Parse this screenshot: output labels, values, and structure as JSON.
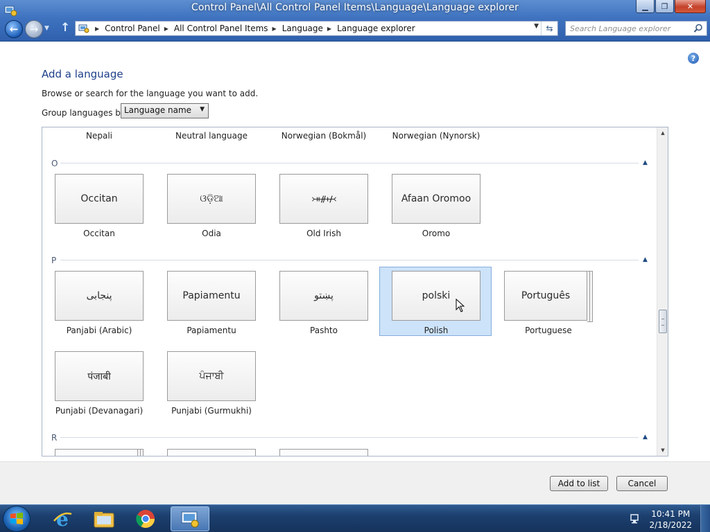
{
  "window": {
    "title": "Control Panel\\All Control Panel Items\\Language\\Language explorer"
  },
  "address": {
    "breadcrumb": [
      "Control Panel",
      "All Control Panel Items",
      "Language",
      "Language explorer"
    ]
  },
  "search": {
    "placeholder": "Search Language explorer"
  },
  "page": {
    "heading": "Add a language",
    "intro": "Browse or search for the language you want to add.",
    "group_label": "Group languages by:",
    "group_value": "Language name"
  },
  "top_row": [
    "Nepali",
    "Neutral language",
    "Norwegian (Bokmål)",
    "Norwegian (Nynorsk)"
  ],
  "sections": [
    {
      "letter": "O",
      "items": [
        {
          "tile": "Occitan",
          "name": "Occitan"
        },
        {
          "tile": "ଓଡ଼ିଆ",
          "name": "Odia"
        },
        {
          "tile": "᚛ᚑᚌᚐᚋ᚜",
          "name": "Old Irish"
        },
        {
          "tile": "Afaan Oromoo",
          "name": "Oromo"
        }
      ]
    },
    {
      "letter": "P",
      "items": [
        {
          "tile": "پنجابی",
          "name": "Panjabi (Arabic)"
        },
        {
          "tile": "Papiamentu",
          "name": "Papiamentu"
        },
        {
          "tile": "پښتو",
          "name": "Pashto"
        },
        {
          "tile": "polski",
          "name": "Polish",
          "selected": true
        },
        {
          "tile": "Português",
          "name": "Portuguese",
          "stacked": true
        },
        {
          "tile": "पंजाबी",
          "name": "Punjabi (Devanagari)"
        },
        {
          "tile": "ਪੰਜਾਬੀ",
          "name": "Punjabi (Gurmukhi)"
        }
      ]
    },
    {
      "letter": "R",
      "items": []
    }
  ],
  "buttons": {
    "add": "Add to list",
    "cancel": "Cancel"
  },
  "taskbar": {
    "time": "10:41 PM",
    "date": "2/18/2022"
  },
  "colors": {
    "heading": "#1e3f8a",
    "selection": "#cde3f9",
    "title_bar": "#3e72bf",
    "taskbar": "#1c3f6e"
  }
}
